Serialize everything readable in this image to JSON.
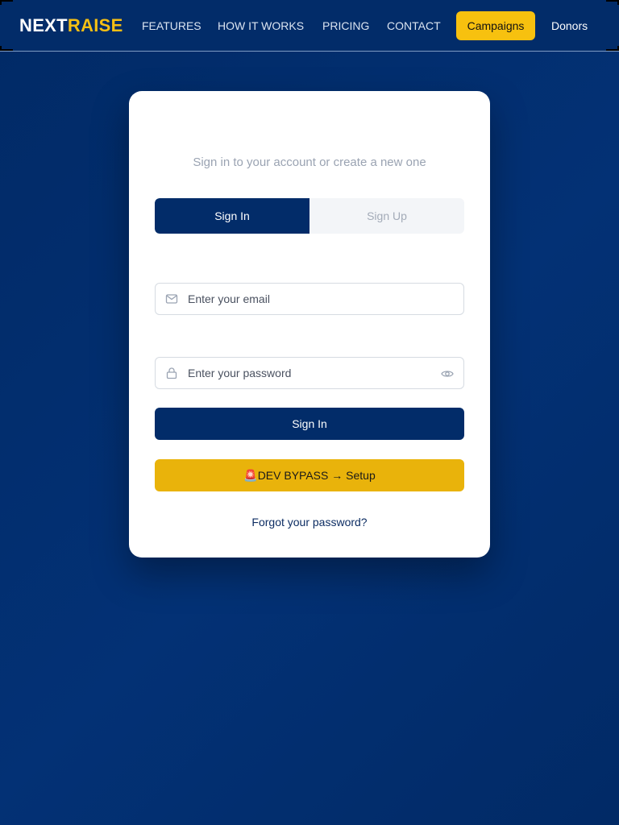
{
  "header": {
    "logo_part1": "NEXT",
    "logo_part2": "RAISE",
    "nav": [
      "FEATURES",
      "HOW IT WORKS",
      "PRICING",
      "CONTACT"
    ],
    "campaigns_label": "Campaigns",
    "donors_label": "Donors"
  },
  "auth": {
    "subtitle": "Sign in to your account or create a new one",
    "tabs": [
      {
        "label": "Sign In",
        "active": true
      },
      {
        "label": "Sign Up",
        "active": false
      }
    ],
    "email": {
      "placeholder": "Enter your email",
      "icon": "mail-icon"
    },
    "password": {
      "placeholder": "Enter your password",
      "icon": "lock-icon",
      "toggle_icon": "eye-icon"
    },
    "submit_label": "Sign In",
    "bypass_label": "🚨DEV BYPASS → Setup",
    "forgot_label": "Forgot your password?"
  },
  "colors": {
    "navy": "#022c69",
    "accent": "#f7c10f",
    "bypass": "#e9b30b"
  }
}
